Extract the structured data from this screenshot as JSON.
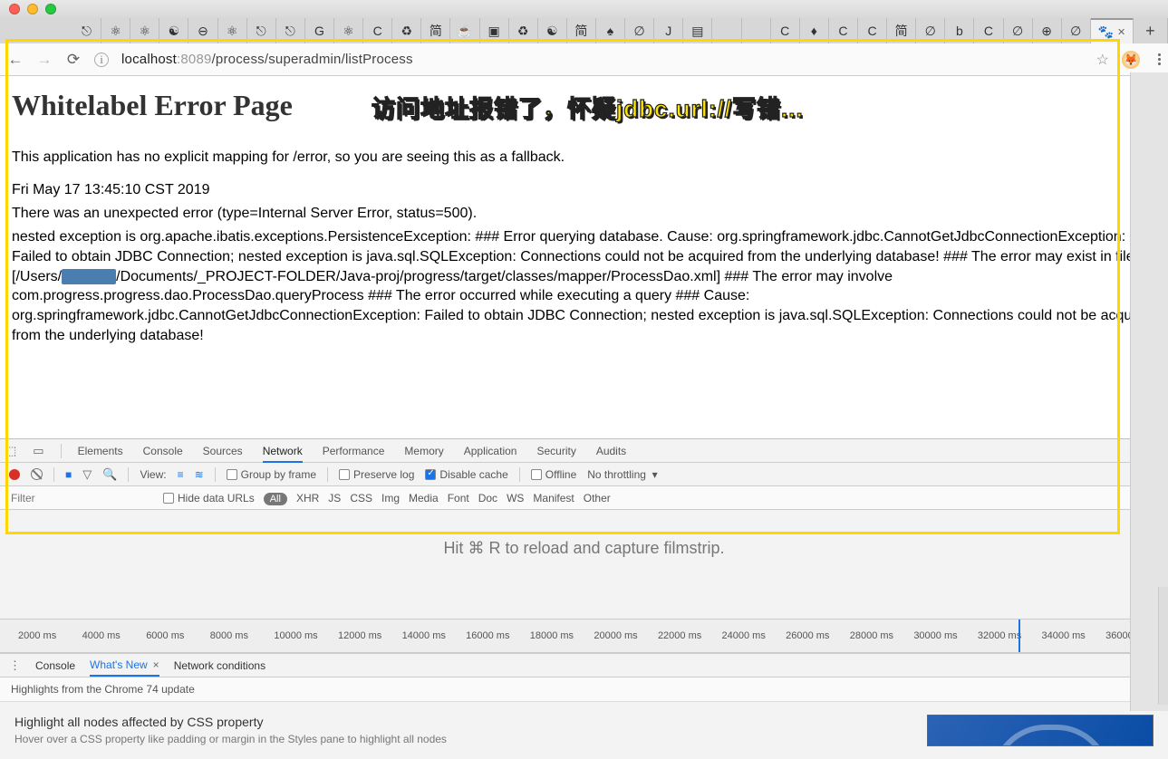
{
  "traffic": {
    "red": "",
    "yellow": "",
    "green": ""
  },
  "tabs_icons": [
    "⎋",
    "⚛",
    "⚛",
    "☯",
    "⊖",
    "⚛",
    "⎋",
    "⎋",
    "G",
    "⚛",
    "C",
    "♻",
    "简",
    "☕",
    "▣",
    "♻",
    "☯",
    "简",
    "♠",
    "∅",
    "J",
    "▤",
    "",
    "",
    "C",
    "♦",
    "C",
    "C",
    "简",
    "∅",
    "b",
    "C",
    "∅",
    "⊕",
    "∅"
  ],
  "active_tab_icon": "🐾",
  "new_tab": "+",
  "nav": {
    "back": "←",
    "forward": "→",
    "reload": "⟳"
  },
  "url": {
    "icon": "i",
    "host": "localhost",
    "port": ":8089",
    "path": "/process/superadmin/listProcess"
  },
  "star": "☆",
  "page": {
    "title": "Whitelabel Error Page",
    "fallback": "This application has no explicit mapping for /error, so you are seeing this as a fallback.",
    "timestamp": "Fri May 17 13:45:10 CST 2019",
    "errline": "There was an unexpected error (type=Internal Server Error, status=500).",
    "body_a": "nested exception is org.apache.ibatis.exceptions.PersistenceException: ### Error querying database. Cause: org.springframework.jdbc.CannotGetJdbcConnectionException: Failed to obtain JDBC Connection; nested exception is java.sql.SQLException: Connections could not be acquired from the underlying database! ### The error may exist in file [/Users/",
    "body_b": "/Documents/_PROJECT-FOLDER/Java-proj/progress/target/classes/mapper/ProcessDao.xml] ### The error may involve com.progress.progress.dao.ProcessDao.queryProcess ### The error occurred while executing a query ### Cause: org.springframework.jdbc.CannotGetJdbcConnectionException: Failed to obtain JDBC Connection; nested exception is java.sql.SQLException: Connections could not be acquired from the underlying database!"
  },
  "annotation": "访问地址报错了，怀疑jdbc.url://写错...",
  "devtools": {
    "tabs": [
      "Elements",
      "Console",
      "Sources",
      "Network",
      "Performance",
      "Memory",
      "Application",
      "Security",
      "Audits"
    ],
    "active_tab": "Network",
    "toolbar": {
      "view": "View:",
      "group": "Group by frame",
      "preserve": "Preserve log",
      "disable": "Disable cache",
      "offline": "Offline",
      "throttle": "No throttling"
    },
    "filter": {
      "placeholder": "Filter",
      "hide": "Hide data URLs",
      "chips": [
        "All",
        "XHR",
        "JS",
        "CSS",
        "Img",
        "Media",
        "Font",
        "Doc",
        "WS",
        "Manifest",
        "Other"
      ]
    },
    "hint": "Hit ⌘ R to reload and capture filmstrip.",
    "ticks": [
      "2000 ms",
      "4000 ms",
      "6000 ms",
      "8000 ms",
      "10000 ms",
      "12000 ms",
      "14000 ms",
      "16000 ms",
      "18000 ms",
      "20000 ms",
      "22000 ms",
      "24000 ms",
      "26000 ms",
      "28000 ms",
      "30000 ms",
      "32000 ms",
      "34000 ms",
      "36000 m"
    ]
  },
  "drawer": {
    "tabs": [
      "Console",
      "What's New",
      "Network conditions"
    ],
    "active": "What's New",
    "close": "×",
    "sub": "Highlights from the Chrome 74 update",
    "h": "Highlight all nodes affected by CSS property",
    "p": "Hover over a CSS property like padding or margin in the Styles pane to highlight all nodes"
  }
}
